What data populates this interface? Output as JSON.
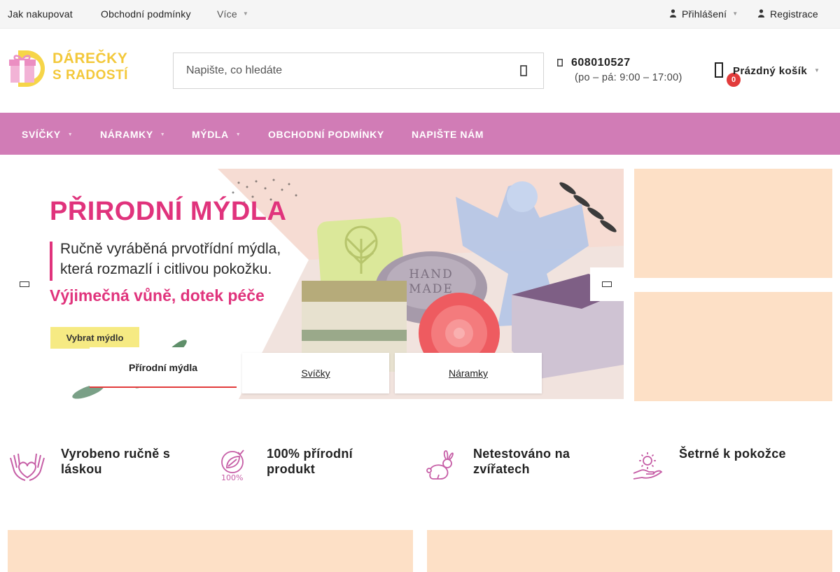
{
  "topbar": {
    "links": [
      "Jak nakupovat",
      "Obchodní podmínky",
      "Více"
    ],
    "login": "Přihlášení",
    "register": "Registrace"
  },
  "header": {
    "logo_line1": "DÁREČKY",
    "logo_line2": "S RADOSTÍ",
    "search_placeholder": "Napište, co hledáte",
    "phone": "608010527",
    "hours": "(po – pá: 9:00 – 17:00)",
    "cart_label": "Prázdný košík",
    "cart_count": "0"
  },
  "nav": {
    "items": [
      "SVÍČKY",
      "NÁRAMKY",
      "MÝDLA",
      "OBCHODNÍ PODMÍNKY",
      "NAPIŠTE NÁM"
    ]
  },
  "banner": {
    "title": "PŘIRODNÍ MÝDLA",
    "subtitle_line1": "Ručně vyráběná prvotřídní mýdla,",
    "subtitle_line2": "která rozmazlí i citlivou pokožku.",
    "tagline": "Výjimečná vůně, dotek péče",
    "button": "Vybrat mýdlo",
    "soap_stamp_line1": "HAND",
    "soap_stamp_line2": "MADE",
    "tabs": [
      "Přírodní mýdla",
      "Svíčky",
      "Náramky"
    ]
  },
  "benefits": [
    {
      "icon": "hands-heart-icon",
      "line1": "Vyrobeno ručně s",
      "line2": "láskou"
    },
    {
      "icon": "natural-100-icon",
      "line1": "100% přírodní",
      "line2": "produkt"
    },
    {
      "icon": "rabbit-icon",
      "line1": "Netestováno na",
      "line2": "zvířatech"
    },
    {
      "icon": "hand-sun-icon",
      "line1": "Šetrné k pokožce",
      "line2": ""
    }
  ],
  "colors": {
    "nav_bg": "#d17cb6",
    "accent_pink": "#e0337c",
    "logo_yellow": "#f3c83a",
    "placeholder_peach": "#fde0c6",
    "badge_red": "#e23b3b"
  }
}
